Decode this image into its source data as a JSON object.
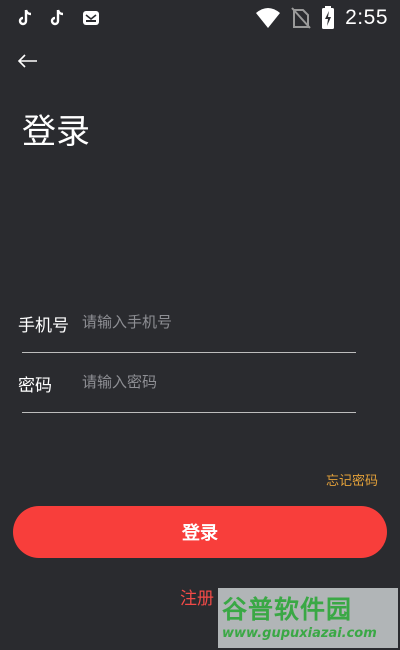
{
  "status_bar": {
    "time": "2:55",
    "icons": [
      "tiktok-icon",
      "tiktok-icon",
      "mail-app-icon",
      "wifi-icon",
      "no-sim-icon",
      "battery-charging-icon"
    ]
  },
  "header": {
    "back_icon": "arrow-left-icon",
    "title": "登录"
  },
  "form": {
    "phone": {
      "label": "手机号",
      "placeholder": "请输入手机号",
      "value": ""
    },
    "password": {
      "label": "密码",
      "placeholder": "请输入密码",
      "value": ""
    },
    "forgot_label": "忘记密码",
    "login_label": "登录",
    "register_label": "注册"
  },
  "watermark": {
    "brand": "谷普软件园",
    "url": "www.gupuxiazai.com"
  },
  "colors": {
    "background": "#2a2b2f",
    "accent": "#f83e3b",
    "forgot": "#e4a23a",
    "watermark_green": "#3aa845"
  }
}
